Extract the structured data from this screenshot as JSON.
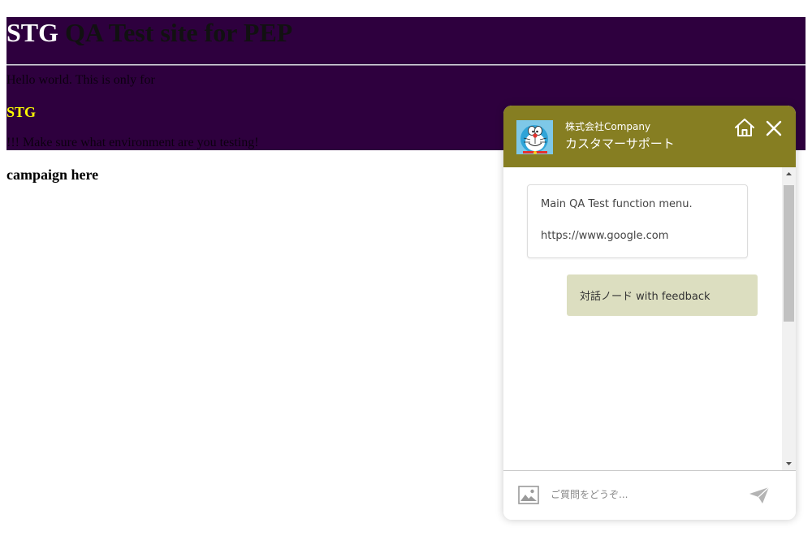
{
  "page": {
    "title_env": "STG",
    "title_rest": " QA Test site for PEP",
    "hello_text": "Hello world. This is only for",
    "env_heading": "STG",
    "warning_text": "!!! Make sure what environment are you testing!",
    "campaign_text": "campaign here"
  },
  "chat": {
    "company_name": "株式会社Company",
    "support_title": "カスタマーサポート",
    "header_icons": [
      "home-icon",
      "close-icon"
    ],
    "messages": [
      {
        "from": "bot",
        "lines": [
          "Main QA Test function menu.",
          "https://www.google.com"
        ]
      },
      {
        "from": "user",
        "text": "対話ノード with feedback"
      }
    ],
    "input_placeholder": "ご質問をどうぞ...",
    "footer_icons": [
      "image-upload-icon",
      "send-icon"
    ],
    "scrollbar_position": 0
  },
  "colors": {
    "banner_bg": "#2e003e",
    "chat_header_bg": "#867e22",
    "user_bubble_bg": "#dcdec0",
    "env_heading": "#ffff00"
  }
}
